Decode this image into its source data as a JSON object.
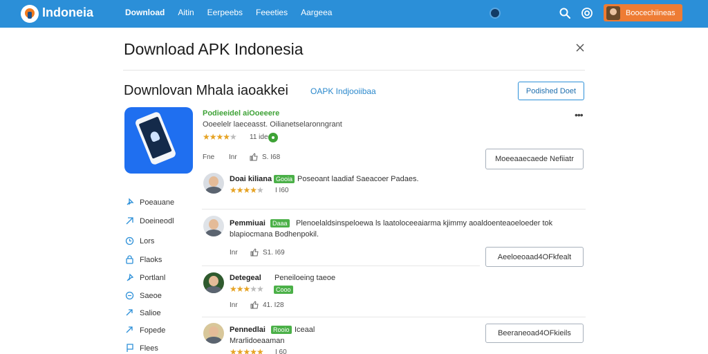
{
  "topbar": {
    "brand": "Indoneia",
    "nav": [
      "Download",
      "Aitin",
      "Eerpeebs",
      "Feeeties",
      "Aargeea"
    ],
    "user_label": "Boocechiineas"
  },
  "dialog": {
    "title": "Download APK Indonesia",
    "close_icon": "close-icon"
  },
  "section": {
    "title": "Downlovan Mhala iaoakkei",
    "subtitle": "OAPK Indjooiibaa",
    "publish_button": "Podished Doet"
  },
  "app": {
    "name": "Podieeidel aiOoeeere",
    "description": "Ooeelelr laeceasst. Oilianetselaronngrant",
    "rating": 4,
    "rating_count": "11 ideen",
    "meta": [
      "Fne",
      "Inr",
      "S. I68"
    ],
    "install_button": "Moeeaaecaede Nefiiatr"
  },
  "sidebar": {
    "items": [
      {
        "label": "Poeauane",
        "icon": "pin-icon"
      },
      {
        "label": "Doeineodl",
        "icon": "download-icon"
      },
      {
        "label": "Lors",
        "icon": "clock-icon"
      },
      {
        "label": "Flaoks",
        "icon": "lock-icon"
      },
      {
        "label": "Portlanl",
        "icon": "pin-icon"
      },
      {
        "label": "Saeoe",
        "icon": "chat-icon"
      },
      {
        "label": "Salioe",
        "icon": "share-icon"
      },
      {
        "label": "Fopede",
        "icon": "share-icon"
      },
      {
        "label": "Flees",
        "icon": "flag-icon"
      }
    ]
  },
  "reviews": [
    {
      "name": "Doai kiliana",
      "tag": "Gooia",
      "text": "Poseoant laadiaf Saeacoer Padaes.",
      "rating": 4,
      "count": "I I60",
      "meta": []
    },
    {
      "name": "Pemmiuai",
      "tag": "Daaa",
      "text": "Plenoelaldsinspeloewa ls laatoloceeaiarma kjimmy aoaldoenteaoeloeder tok",
      "text2": "blapiocmana Bodhenpokil.",
      "meta": [
        "Inr",
        "S1. I69"
      ],
      "button": "Aeeloeoaad4OFkfealt"
    },
    {
      "name": "Detegeal",
      "tag": "",
      "text": "Peneiloeing taeoe",
      "rating": 3,
      "badge": "Cooo",
      "meta": [
        "Inr",
        "41. I28"
      ]
    },
    {
      "name": "Pennedlai",
      "tag": "Rooio",
      "text": "Iceaal",
      "text2": "Mrarlidoeaaman",
      "rating": 5,
      "count": "I 60",
      "button": "Beeraneoad4OFkieils"
    }
  ],
  "colors": {
    "topbar": "#2b8fd8",
    "user_button": "#ee7c34",
    "accent_green": "#3ea236",
    "star": "#e6a324"
  }
}
